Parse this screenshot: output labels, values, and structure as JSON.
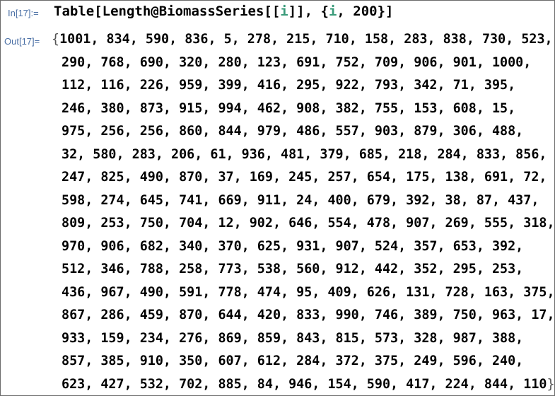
{
  "input": {
    "label": "In[17]:=",
    "code_head": "Table[Length@BiomassSeries[[",
    "code_i1": "i",
    "code_mid": "]], {",
    "code_i2": "i",
    "code_tail": ", 200}]"
  },
  "output": {
    "label": "Out[17]=",
    "open_brace": "{",
    "close_brace": "}",
    "lines": [
      "1001, 834, 590, 836, 5, 278, 215, 710, 158, 283, 838, 730, 523,",
      "290, 768, 690, 320, 280, 123, 691, 752, 709, 906, 901, 1000,",
      "112, 116, 226, 959, 399, 416, 295, 922, 793, 342, 71, 395,",
      "246, 380, 873, 915, 994, 462, 908, 382, 755, 153, 608, 15,",
      "975, 256, 256, 860, 844, 979, 486, 557, 903, 879, 306, 488,",
      "32, 580, 283, 206, 61, 936, 481, 379, 685, 218, 284, 833, 856,",
      "247, 825, 490, 870, 37, 169, 245, 257, 654, 175, 138, 691, 72,",
      "598, 274, 645, 741, 669, 911, 24, 400, 679, 392, 38, 87, 437,",
      "809, 253, 750, 704, 12, 902, 646, 554, 478, 907, 269, 555, 318,",
      "970, 906, 682, 340, 370, 625, 931, 907, 524, 357, 653, 392,",
      "512, 346, 788, 258, 773, 538, 560, 912, 442, 352, 295, 253,",
      "436, 967, 490, 591, 778, 474, 95, 409, 626, 131, 728, 163, 375,",
      "867, 286, 459, 870, 644, 420, 833, 990, 746, 389, 750, 963, 17,",
      "933, 159, 234, 276, 869, 859, 843, 815, 573, 328, 987, 388,",
      "857, 385, 910, 350, 607, 612, 284, 372, 375, 249, 596, 240,",
      "623, 427, 532, 702, 885, 84, 946, 154, 590, 417, 224, 844, 110"
    ]
  }
}
